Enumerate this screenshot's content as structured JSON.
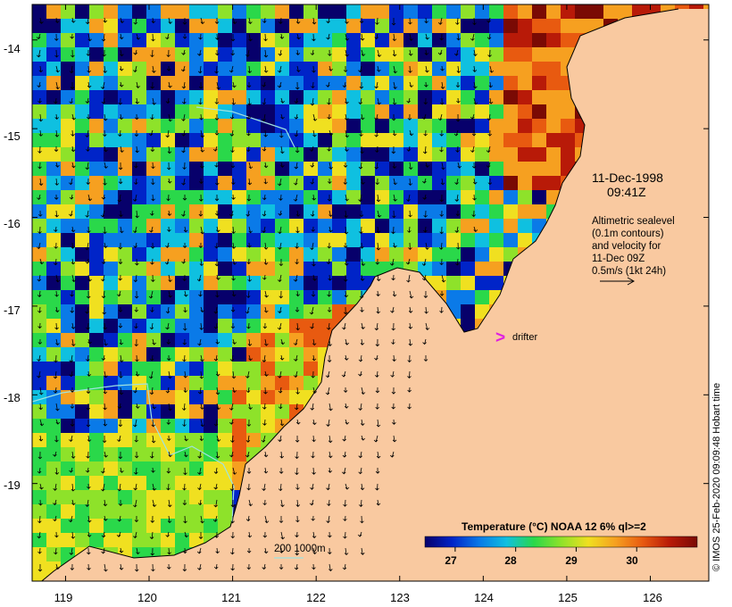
{
  "map": {
    "date": "11-Dec-1998",
    "time": "09:41Z",
    "altimetry_lines": [
      "Altimetric sealevel",
      "(0.1m contours)",
      "and velocity for",
      "11-Dec 09Z",
      "0.5m/s (1kt 24h)"
    ],
    "drifter_marker": ">",
    "drifter_label": "drifter",
    "scale_label": "200  1000m",
    "credit": "© IMOS 25-Feb-2020 09:09:48 Hobart time",
    "extent": {
      "lon": [
        118.6,
        126.7
      ],
      "lat": [
        -20.1,
        -13.6
      ]
    },
    "lon_ticks": [
      119,
      120,
      121,
      122,
      123,
      124,
      125,
      126
    ],
    "lat_ticks": [
      -14,
      -15,
      -16,
      -17,
      -18,
      -19
    ],
    "colors": {
      "land": "#f9c9a0",
      "drifter": "#e020e0",
      "bathymetry_contour": "#9fe3e0"
    }
  },
  "colorbar": {
    "title": "Temperature (°C) NOAA 12 6% ql>=2",
    "range": [
      26.5,
      31.0
    ],
    "ticks": [
      "27",
      "28",
      "29",
      "30"
    ],
    "colors": [
      "#07006b",
      "#0024c8",
      "#0a7ae8",
      "#0fc0e0",
      "#2ad84a",
      "#8ee22a",
      "#f0e020",
      "#f6a020",
      "#e85a10",
      "#b81a08",
      "#7a0a04"
    ]
  }
}
